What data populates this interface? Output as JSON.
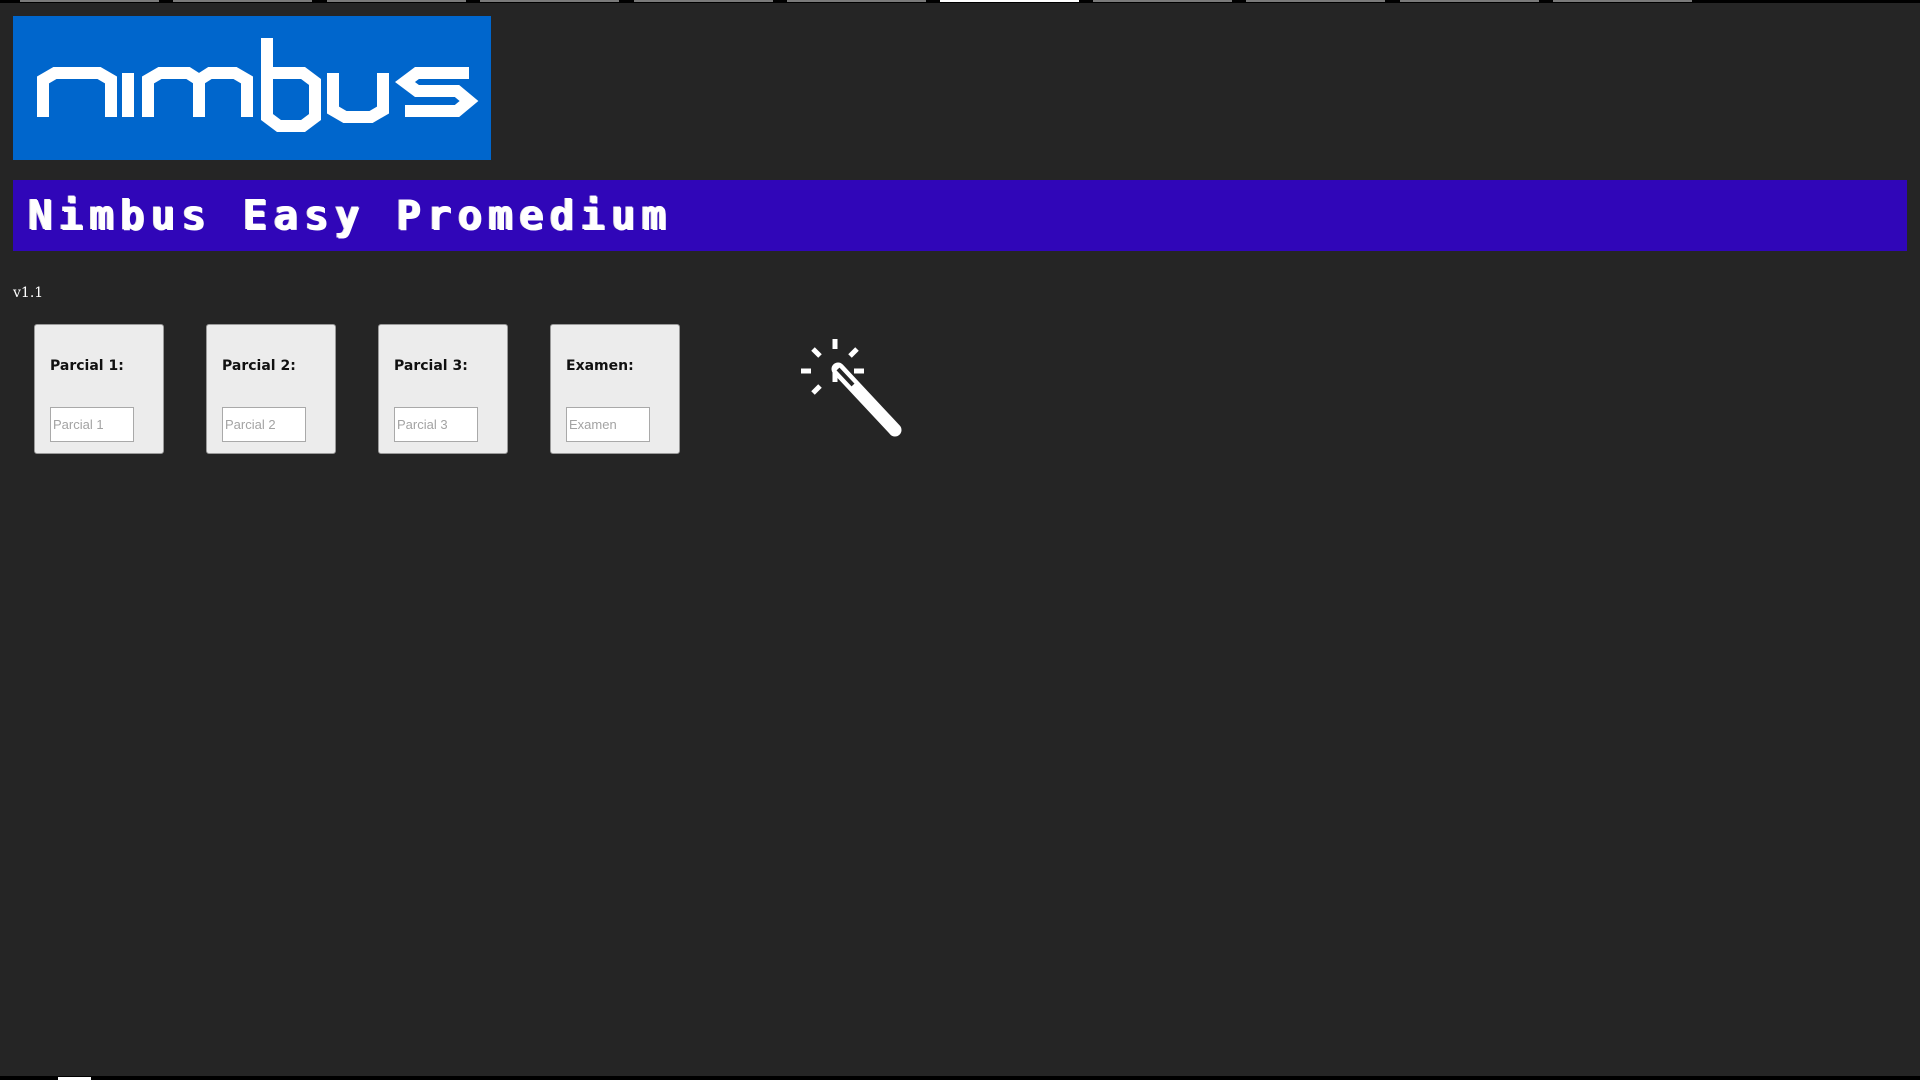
{
  "app": {
    "logo_text": "nimbus",
    "title": "Nimbus Easy Promedium",
    "version": "v1.1"
  },
  "grades": [
    {
      "label": "Parcial 1:",
      "placeholder": "Parcial 1",
      "value": ""
    },
    {
      "label": "Parcial 2:",
      "placeholder": "Parcial 2",
      "value": ""
    },
    {
      "label": "Parcial 3:",
      "placeholder": "Parcial 3",
      "value": ""
    },
    {
      "label": "Examen:",
      "placeholder": "Examen",
      "value": ""
    }
  ],
  "actions": {
    "calculate_icon": "magic-wand-icon"
  },
  "colors": {
    "background": "#252525",
    "logo_bg": "#0066cc",
    "title_bg": "#3006b8",
    "card_bg": "#ececec"
  }
}
